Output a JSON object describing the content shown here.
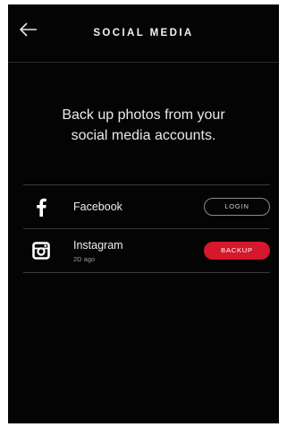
{
  "header": {
    "title": "SOCIAL MEDIA",
    "back_icon": "arrow-left-icon"
  },
  "intro": {
    "line1": "Back up photos from your",
    "line2": "social media accounts."
  },
  "accounts": [
    {
      "icon": "facebook-icon",
      "name": "Facebook",
      "subtext": "",
      "action_label": "LOGIN",
      "action_style": "outline"
    },
    {
      "icon": "instagram-icon",
      "name": "Instagram",
      "subtext": "2D ago",
      "action_label": "BACKUP",
      "action_style": "solid",
      "action_color": "#d6182c"
    }
  ],
  "colors": {
    "background": "#040404",
    "text": "#ffffff",
    "accent": "#d6182c",
    "divider": "#3a3a3a"
  }
}
